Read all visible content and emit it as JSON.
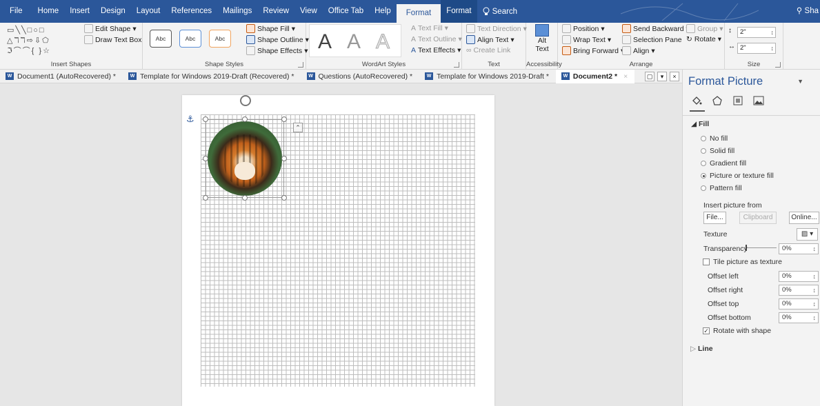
{
  "menubar": {
    "tabs": [
      "File",
      "Home",
      "Insert",
      "Design",
      "Layout",
      "References",
      "Mailings",
      "Review",
      "View",
      "Office Tab",
      "Help"
    ],
    "active_tab": "Format",
    "context_tab": "Format",
    "search": "Search",
    "share": "Sha"
  },
  "ribbon": {
    "insert_shapes": {
      "label": "Insert Shapes",
      "edit_shape": "Edit Shape",
      "draw_text_box": "Draw Text Box"
    },
    "shape_styles": {
      "label": "Shape Styles",
      "sample": "Abc",
      "fill": "Shape Fill",
      "outline": "Shape Outline",
      "effects": "Shape Effects"
    },
    "wordart": {
      "label": "WordArt Styles",
      "letter": "A",
      "text_fill": "Text Fill",
      "text_outline": "Text Outline",
      "text_effects": "Text Effects"
    },
    "text": {
      "label": "Text",
      "direction": "Text Direction",
      "align": "Align Text",
      "create_link": "Create Link"
    },
    "accessibility": {
      "label": "Accessibility",
      "alt_text_1": "Alt",
      "alt_text_2": "Text"
    },
    "arrange": {
      "label": "Arrange",
      "position": "Position",
      "wrap_text": "Wrap Text",
      "bring_forward": "Bring Forward",
      "send_backward": "Send Backward",
      "selection_pane": "Selection Pane",
      "align": "Align",
      "group": "Group",
      "rotate": "Rotate"
    },
    "size": {
      "label": "Size",
      "height": "2\"",
      "width": "2\""
    }
  },
  "doc_tabs": [
    {
      "name": "Document1 (AutoRecovered) *",
      "active": false
    },
    {
      "name": "Template for Windows 2019-Draft (Recovered) *",
      "active": false
    },
    {
      "name": "Questions (AutoRecovered) *",
      "active": false
    },
    {
      "name": "Template for Windows 2019-Draft *",
      "active": false
    },
    {
      "name": "Document2 *",
      "active": true
    }
  ],
  "pane": {
    "title": "Format Picture",
    "fill_section": "Fill",
    "fill_options": [
      {
        "label": "No fill",
        "selected": false
      },
      {
        "label": "Solid fill",
        "selected": false
      },
      {
        "label": "Gradient fill",
        "selected": false
      },
      {
        "label": "Picture or texture fill",
        "selected": true
      },
      {
        "label": "Pattern fill",
        "selected": false
      }
    ],
    "insert_from": "Insert picture from",
    "file_btn": "File...",
    "clipboard_btn": "Clipboard",
    "online_btn": "Online...",
    "texture": "Texture",
    "transparency": "Transparency",
    "transparency_value": "0%",
    "tile": "Tile picture as texture",
    "offsets": [
      {
        "label": "Offset left",
        "value": "0%"
      },
      {
        "label": "Offset right",
        "value": "0%"
      },
      {
        "label": "Offset top",
        "value": "0%"
      },
      {
        "label": "Offset bottom",
        "value": "0%"
      }
    ],
    "rotate_with_shape": "Rotate with shape",
    "line_section": "Line"
  },
  "colors": {
    "brand": "#2b579a",
    "ribbon": "#f3f3f3"
  }
}
